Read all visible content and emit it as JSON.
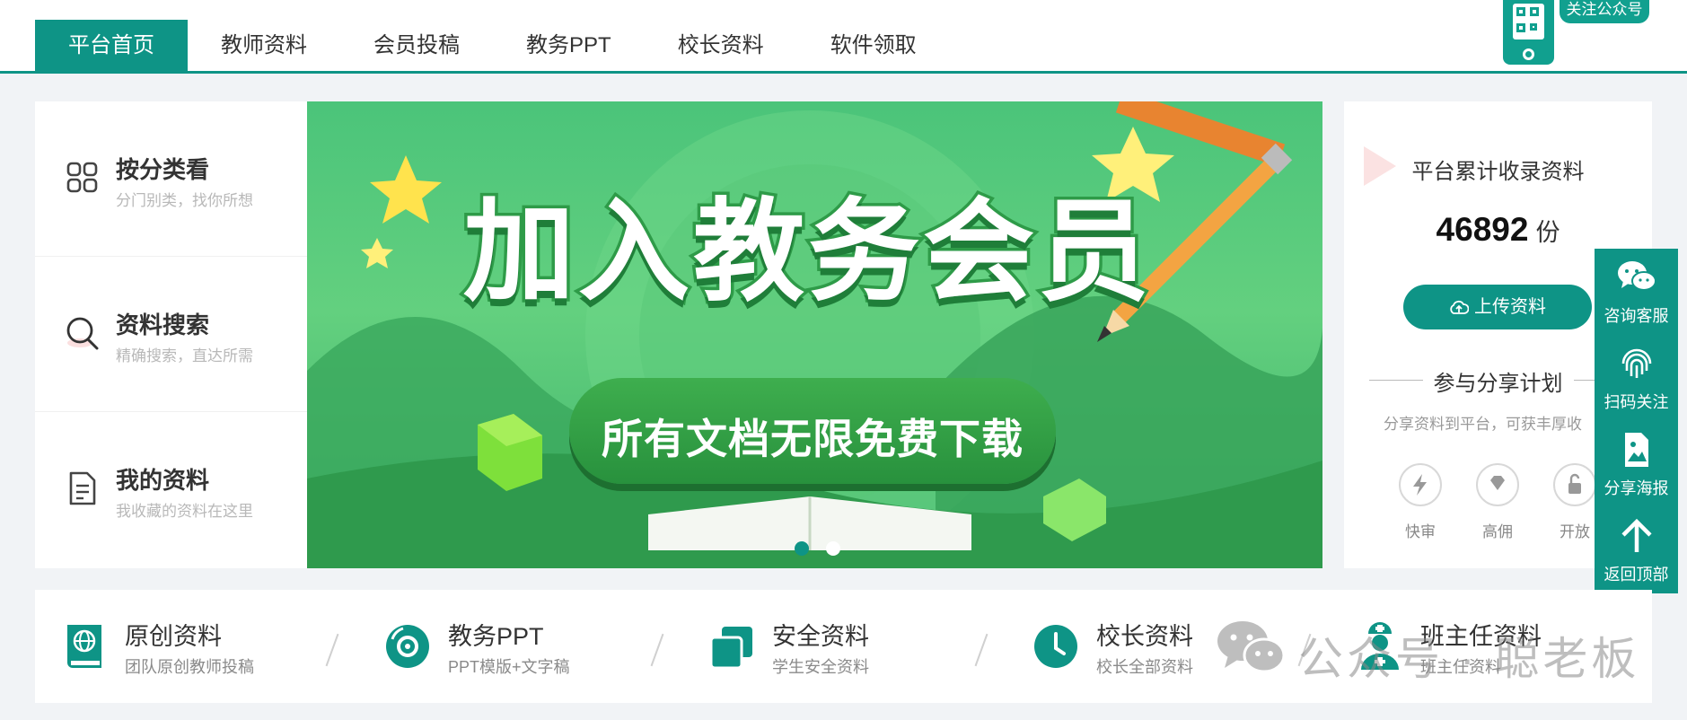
{
  "nav": {
    "items": [
      {
        "label": "平台首页",
        "active": true
      },
      {
        "label": "教师资料",
        "active": false
      },
      {
        "label": "会员投稿",
        "active": false
      },
      {
        "label": "教务PPT",
        "active": false
      },
      {
        "label": "校长资料",
        "active": false
      },
      {
        "label": "软件领取",
        "active": false
      }
    ],
    "follow_label": "关注公众号",
    "qr_icon": "phone-qr-icon"
  },
  "left_panel": {
    "items": [
      {
        "title": "按分类看",
        "desc": "分门别类，找你所想",
        "icon": "category-grid-icon"
      },
      {
        "title": "资料搜索",
        "desc": "精确搜索，直达所需",
        "icon": "search-icon"
      },
      {
        "title": "我的资料",
        "desc": "我收藏的资料在这里",
        "icon": "document-icon"
      }
    ]
  },
  "banner": {
    "headline": "加入教务会员",
    "subline": "所有文档无限免费下载",
    "slides": 2,
    "active_slide": 1
  },
  "right_panel": {
    "title": "平台累计收录资料",
    "count": "46892",
    "unit": "份",
    "upload_label": "上传资料",
    "share_title": "参与分享计划",
    "share_desc": "分享资料到平台，可获丰厚收",
    "features": [
      {
        "label": "快审",
        "icon": "lightning-icon"
      },
      {
        "label": "高佣",
        "icon": "diamond-icon"
      },
      {
        "label": "开放",
        "icon": "unlock-icon"
      }
    ]
  },
  "sidebar": {
    "items": [
      {
        "label": "咨询客服",
        "icon": "wechat-chat-icon"
      },
      {
        "label": "扫码关注",
        "icon": "fingerprint-icon"
      },
      {
        "label": "分享海报",
        "icon": "poster-image-icon"
      },
      {
        "label": "返回顶部",
        "icon": "arrow-up-icon"
      }
    ]
  },
  "categories": [
    {
      "title": "原创资料",
      "desc": "团队原创教师投稿",
      "icon": "globe-book-icon"
    },
    {
      "title": "教务PPT",
      "desc": "PPT模版+文字稿",
      "icon": "disc-icon"
    },
    {
      "title": "安全资料",
      "desc": "学生安全资料",
      "icon": "stacked-squares-icon"
    },
    {
      "title": "校长资料",
      "desc": "校长全部资料",
      "icon": "clock-icon"
    },
    {
      "title": "班主任资料",
      "desc": "班主任资料",
      "icon": "nurse-person-icon"
    }
  ],
  "watermark": {
    "text": "公众号 · 聪老板",
    "icon": "wechat-logo-icon"
  },
  "colors": {
    "primary": "#0e9486",
    "banner_green": "#4bc47a",
    "text_dark": "#333333",
    "text_muted": "#b8b8b8"
  }
}
